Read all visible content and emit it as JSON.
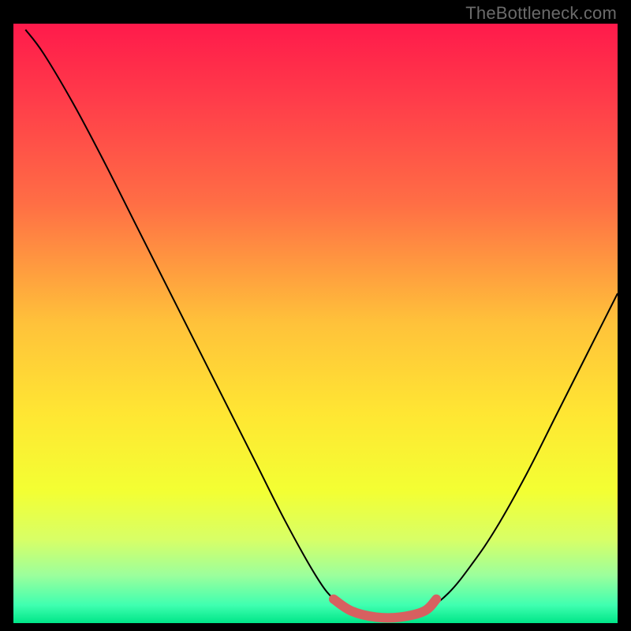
{
  "watermark": "TheBottleneck.com",
  "chart_data": {
    "type": "line",
    "title": "",
    "xlabel": "",
    "ylabel": "",
    "xlim": [
      0,
      100
    ],
    "ylim": [
      0,
      100
    ],
    "gradient_stops": [
      {
        "offset": 0,
        "color": "#ff1a4b"
      },
      {
        "offset": 12,
        "color": "#ff3a4a"
      },
      {
        "offset": 30,
        "color": "#ff6e45"
      },
      {
        "offset": 50,
        "color": "#ffc23a"
      },
      {
        "offset": 65,
        "color": "#ffe633"
      },
      {
        "offset": 78,
        "color": "#f3ff33"
      },
      {
        "offset": 86,
        "color": "#d8ff66"
      },
      {
        "offset": 92,
        "color": "#9cff9c"
      },
      {
        "offset": 97,
        "color": "#3fffb0"
      },
      {
        "offset": 100,
        "color": "#00e688"
      }
    ],
    "series": [
      {
        "name": "bottleneck-curve",
        "stroke": "#000000",
        "stroke_width": 2,
        "points": [
          {
            "x": 2.0,
            "y": 99.0
          },
          {
            "x": 5.0,
            "y": 95.0
          },
          {
            "x": 10.0,
            "y": 86.5
          },
          {
            "x": 15.0,
            "y": 77.0
          },
          {
            "x": 20.0,
            "y": 67.0
          },
          {
            "x": 25.0,
            "y": 57.0
          },
          {
            "x": 30.0,
            "y": 47.0
          },
          {
            "x": 35.0,
            "y": 37.0
          },
          {
            "x": 40.0,
            "y": 27.0
          },
          {
            "x": 45.0,
            "y": 17.0
          },
          {
            "x": 50.0,
            "y": 8.0
          },
          {
            "x": 53.0,
            "y": 4.0
          },
          {
            "x": 56.0,
            "y": 2.0
          },
          {
            "x": 60.0,
            "y": 1.0
          },
          {
            "x": 64.0,
            "y": 1.0
          },
          {
            "x": 68.0,
            "y": 2.0
          },
          {
            "x": 72.0,
            "y": 5.0
          },
          {
            "x": 76.0,
            "y": 10.0
          },
          {
            "x": 80.0,
            "y": 16.0
          },
          {
            "x": 85.0,
            "y": 25.0
          },
          {
            "x": 90.0,
            "y": 35.0
          },
          {
            "x": 95.0,
            "y": 45.0
          },
          {
            "x": 100.0,
            "y": 55.0
          }
        ]
      },
      {
        "name": "highlight-segment",
        "stroke": "#d76060",
        "stroke_width": 12,
        "linecap": "round",
        "points": [
          {
            "x": 53.0,
            "y": 4.0
          },
          {
            "x": 56.0,
            "y": 2.0
          },
          {
            "x": 60.0,
            "y": 1.0
          },
          {
            "x": 64.0,
            "y": 1.0
          },
          {
            "x": 68.0,
            "y": 2.0
          },
          {
            "x": 70.0,
            "y": 4.0
          }
        ]
      }
    ]
  }
}
